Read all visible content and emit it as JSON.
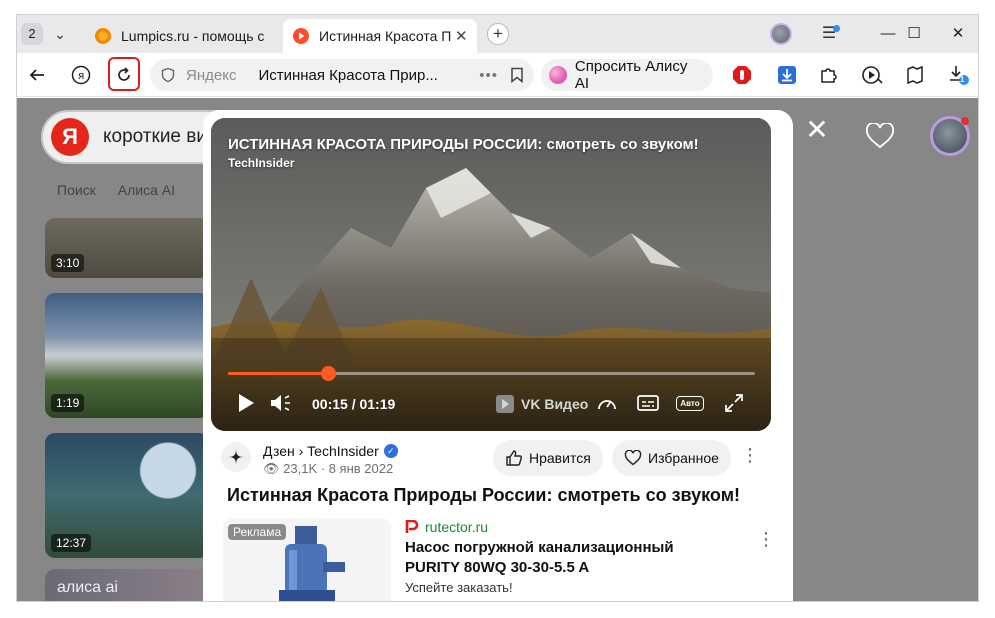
{
  "tabstrip": {
    "tab_count": "2",
    "tabs": [
      {
        "label": "Lumpics.ru - помощь с ком"
      },
      {
        "label": "Истинная Красота При"
      }
    ]
  },
  "toolbar": {
    "omnibox_host": "Яндекс",
    "omnibox_title": "Истинная Красота Прир...",
    "ask_alice": "Спросить Алису AI",
    "downloads_badge": "1"
  },
  "serp": {
    "query": "короткие ви",
    "tabs": [
      "Поиск",
      "Алиса AI"
    ],
    "thumbs": [
      {
        "duration": "3:10"
      },
      {
        "duration": "1:19"
      },
      {
        "duration": "12:37"
      }
    ],
    "alice_promo": "алиса ai"
  },
  "video": {
    "title": "ИСТИННАЯ КРАСОТА ПРИРОДЫ РОССИИ: смотреть со звуком!",
    "channel": "TechInsider",
    "time": "00:15 / 01:19",
    "progress": 0.19,
    "vk_label": "VK Видео",
    "quality_label": "Авто"
  },
  "info": {
    "source": "Дзен › TechInsider",
    "views": "23,1K",
    "date": "8 янв 2022",
    "like_label": "Нравится",
    "fav_label": "Избранное",
    "title": "Истинная Красота Природы России: смотреть со звуком!"
  },
  "ad": {
    "badge": "Реклама",
    "site": "rutector.ru",
    "title": "Насос погружной канализационный PURITY 80WQ 30-30-5.5 A",
    "cta": "Успейте заказать!"
  },
  "colors": {
    "accent": "#ff5a1f",
    "highlight": "#e01b1b",
    "yandex_red": "#e5261b",
    "verified": "#2f6de0"
  }
}
